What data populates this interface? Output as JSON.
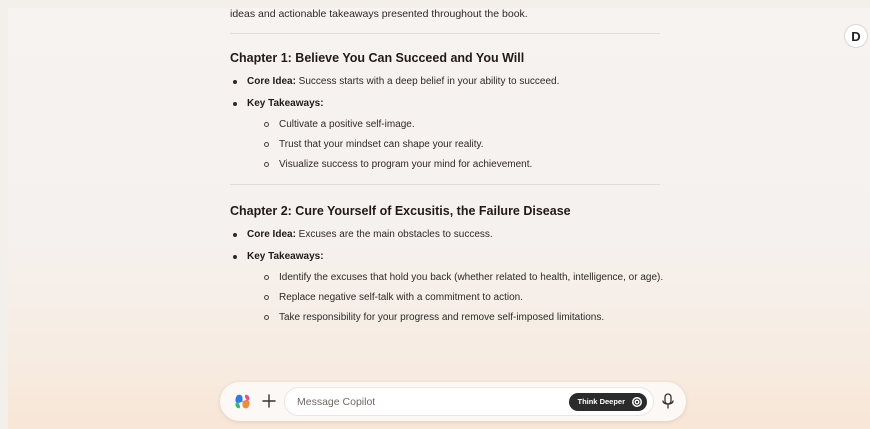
{
  "avatar": {
    "initial": "D"
  },
  "intro": "ideas and actionable takeaways presented throughout the book.",
  "chapters": [
    {
      "title": "Chapter 1: Believe You Can Succeed and You Will",
      "core_label": "Core Idea:",
      "core_text": " Success starts with a deep belief in your ability to succeed.",
      "takeaways_label": "Key Takeaways:",
      "takeaways": [
        "Cultivate a positive self-image.",
        "Trust that your mindset can shape your reality.",
        "Visualize success to program your mind for achievement."
      ]
    },
    {
      "title": "Chapter 2: Cure Yourself of Excusitis, the Failure Disease",
      "core_label": "Core Idea:",
      "core_text": " Excuses are the main obstacles to success.",
      "takeaways_label": "Key Takeaways:",
      "takeaways": [
        "Identify the excuses that hold you back (whether related to health, intelligence, or age).",
        "Replace negative self-talk with a commitment to action.",
        "Take responsibility for your progress and remove self-imposed limitations."
      ]
    }
  ],
  "composer": {
    "placeholder": "Message Copilot",
    "think_deeper_label": "Think Deeper",
    "icons": {
      "logo": "copilot-logo-icon",
      "add": "plus-icon",
      "think": "think-deeper-icon",
      "mic": "microphone-icon"
    }
  }
}
